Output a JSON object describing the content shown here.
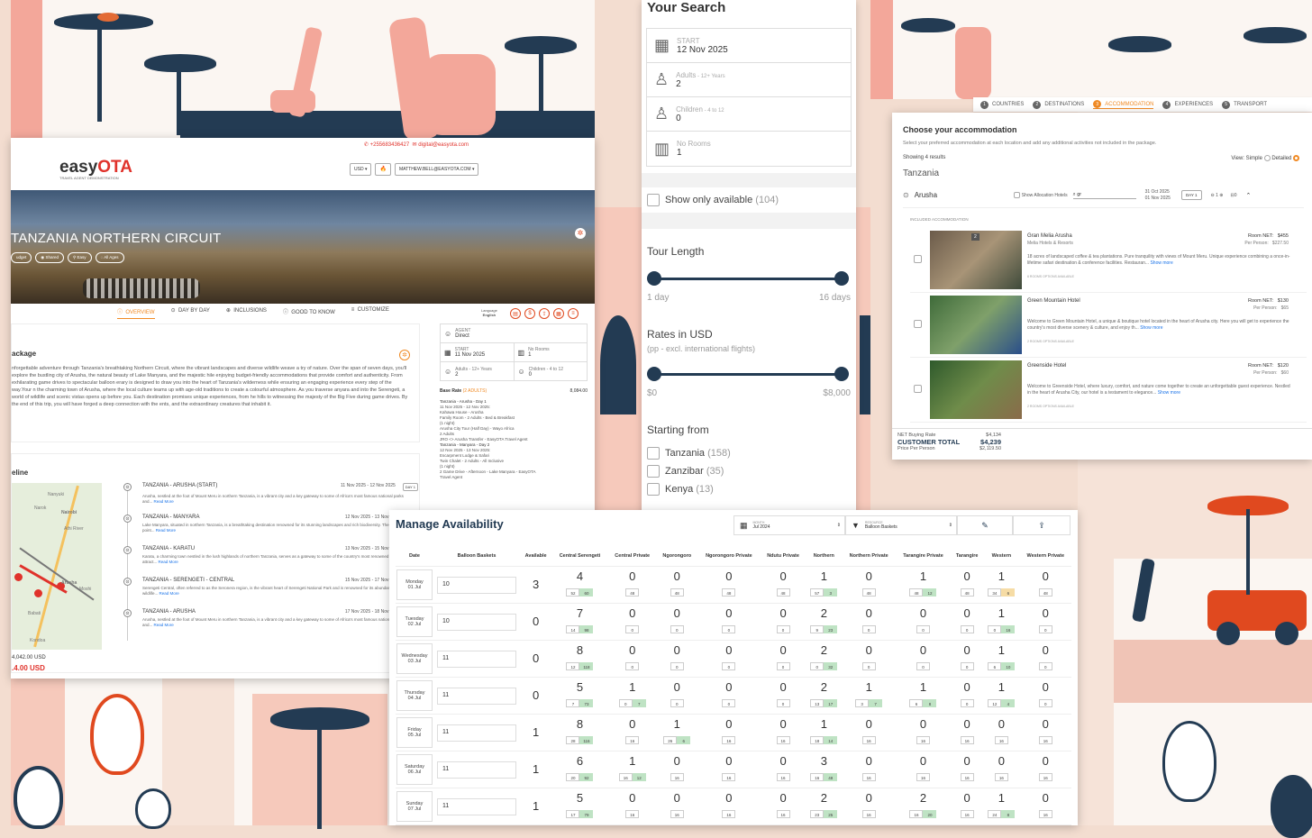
{
  "left_card": {
    "contact_phone": "+255683436427",
    "contact_email": "digital@easyota.com",
    "logo_easy": "easy",
    "logo_ota": "OTA",
    "logo_tagline": "TRAVEL AGENT DEMONSTRATION",
    "currency": "USD ▾",
    "user": "MATTHEW.BELL@EASYOTA.COM ▾",
    "hero_title": "TANZANIA NORTHERN CIRCUIT",
    "hero_tags": [
      "udget",
      "Shared",
      "Easy",
      "All Ages"
    ],
    "tabs": [
      "OVERVIEW",
      "DAY BY DAY",
      "INCLUSIONS",
      "GOOD TO KNOW",
      "CUSTOMIZE"
    ],
    "language_label": "Language",
    "language_value": "English",
    "package_title": "ackage",
    "package_text": "nforgettable adventure through Tanzania's breathtaking Northern Circuit, where the vibrant landscapes and diverse wildlife weave a try of nature. Over the span of seven days, you'll explore the bustling city of Arusha, the natural beauty of Lake Manyara, and the majestic hile enjoying budget-friendly accommodations that provide comfort and authenticity. From exhilarating game drives to spectacular balloon erary is designed to draw you into the heart of Tanzania's wilderness while ensuring an engaging experience every step of the way.Your n the charming town of Arusha, where the local culture teams up with age-old traditions to create a colourful atmosphere. As you traverse anyara and into the Serengeti, a world of wildlife and scenic vistas opens up before you. Each destination promises unique experiences, from he hills to witnessing the majesty of the Big Five during game drives. By the end of this trip, you will have forged a deep connection with the ents, and the extraordinary creatures that inhabit it.",
    "agent_label": "AGENT",
    "agent_value": "Direct",
    "start_label": "START",
    "start_value": "11 Nov 2025",
    "rooms_label": "No Rooms",
    "rooms_value": "1",
    "adults_label": "Adults - 12+ Years",
    "adults_value": "2",
    "children_label": "Children - 4 to 12",
    "children_value": "0",
    "base_rate_label": "Base Rate",
    "base_rate_sub": "(2 ADULTS)",
    "base_rate_value": "8,084.00",
    "itinerary_lines": [
      "Tanzania - Arusha - Day 1",
      "11 Nov 2025 - 12 Nov 2025:",
      "Kahawa House - Arusha",
      "Family Room - 2 Adults - Bed & Breakfast",
      "(1 night)",
      "Arusha City Tour (Half Day) - Wayo Africa",
      "2 Adults",
      "JRO <> Arusha Transfer - EasyOTA Travel Agent",
      "Tanzania - Manyara - Day 2",
      "12 Nov 2025 - 13 Nov 2025:",
      "Escarpment Lodge & Safari",
      "Twin Chalet - 2 Adults - All Inclusive",
      "(1 night)",
      "2 Game Drive - Afternoon - Lake Manyara - EasyOTA",
      "Travel Agent"
    ],
    "timeline_title": "eline",
    "map_labels": [
      "Nanyuki",
      "Narok",
      "Nairobi",
      "Athi River",
      "Arusha",
      "Moshi",
      "Babati",
      "Kondoa"
    ],
    "timeline": [
      {
        "title": "TANZANIA - ARUSHA (START)",
        "dates": "11 Nov 2025 - 12 Nov 2025",
        "badge": "DAY 1",
        "desc": "Arusha, nestled at the foot of Mount Meru in northern Tanzania, is a vibrant city and a key gateway to some of Africa's most famous national parks and...",
        "more": "Read More"
      },
      {
        "title": "TANZANIA - MANYARA",
        "dates": "12 Nov 2025 - 13 Nov 2025",
        "badge": "",
        "desc": "Lake Manyara, situated in northern Tanzania, is a breathtaking destination renowned for its stunning landscapes and rich biodiversity. The focal point...",
        "more": "Read More"
      },
      {
        "title": "TANZANIA - KARATU",
        "dates": "13 Nov 2025 - 15 Nov 2025",
        "badge": "",
        "desc": "Karatu, a charming town nestled in the lush highlands of northern Tanzania, serves as a gateway to some of the country's most renowned natural attract...",
        "more": "Read More"
      },
      {
        "title": "TANZANIA - SERENGETI - CENTRAL",
        "dates": "15 Nov 2025 - 17 Nov 2025",
        "badge": "",
        "desc": "Serengeti Central, often referred to as the Seronera region, is the vibrant heart of Serengeti National Park and is renowned for its abundant wildlife...",
        "more": "Read More"
      },
      {
        "title": "TANZANIA - ARUSHA",
        "dates": "17 Nov 2025 - 18 Nov 2025",
        "badge": "",
        "desc": "Arusha, nestled at the foot of Mount Meru in northern Tanzania, is a vibrant city and a key gateway to some of Africa's most famous national parks and...",
        "more": "Read More"
      }
    ],
    "price_total": "4,042.00 USD",
    "price_pp": ".4.00 USD"
  },
  "search": {
    "title": "Your Search",
    "start_label": "START",
    "start_value": "12 Nov 2025",
    "adults_label": "Adults",
    "adults_sub": " - 12+ Years",
    "adults_value": "2",
    "children_label": "Children",
    "children_sub": " - 4 to 12",
    "children_value": "0",
    "rooms_label": "No Rooms",
    "rooms_value": "1",
    "show_available": "Show only available",
    "show_available_count": "(104)",
    "tour_length_title": "Tour Length",
    "tour_min": "1 day",
    "tour_max": "16 days",
    "rates_title": "Rates in USD",
    "rates_sub": "(pp - excl. international flights)",
    "rates_min": "$0",
    "rates_max": "$8,000",
    "starting_title": "Starting from",
    "starting_options": [
      {
        "name": "Tanzania",
        "count": "(158)"
      },
      {
        "name": "Zanzibar",
        "count": "(35)"
      },
      {
        "name": "Kenya",
        "count": "(13)"
      }
    ]
  },
  "accommodation": {
    "steps": [
      {
        "num": "1",
        "label": "COUNTRIES"
      },
      {
        "num": "2",
        "label": "DESTINATIONS"
      },
      {
        "num": "3",
        "label": "ACCOMMODATION"
      },
      {
        "num": "4",
        "label": "EXPERIENCES"
      },
      {
        "num": "5",
        "label": "TRANSPORT"
      }
    ],
    "title": "Choose your accommodation",
    "subtitle": "Select your preferred accommodation at each location and add any additional activities not included in the package.",
    "showing": "Showing 4 results",
    "view_label": "View:",
    "view_simple": "Simple",
    "view_detailed": "Detailed",
    "country": "Tanzania",
    "location": "Arusha",
    "show_alloc": "Show Allocation Hotels",
    "search_value": "gr",
    "date_from": "31 Oct 2025",
    "date_to": "01 Nov 2025",
    "day_badge": "DAY 1",
    "stepper": "1",
    "rooms_badge": "0",
    "included": "INCLUDED ACCOMMODATION",
    "hotels": [
      {
        "name": "Gran Melia Arusha",
        "sub": "Melia Hotels & Resorts",
        "room_net": "Room NET:",
        "room_net_val": "$455",
        "pp": "Per Person:",
        "pp_val": "$227.50",
        "desc": "18 acres of landscaped coffee & tea plantations. Pure tranquility with views of Mount Meru. Unique experience combining a once-in-lifetime safari destination & conference facilities. Restauran...",
        "more": "Show more",
        "options": "6 ROOMS OPTIONS AVAILABLE",
        "photo_badge": "2"
      },
      {
        "name": "Green Mountain Hotel",
        "sub": "",
        "room_net": "Room NET:",
        "room_net_val": "$130",
        "pp": "Per Person:",
        "pp_val": "$65",
        "desc": "Welcome to Green Mountain Hotel, a unique & boutique hotel located in the heart of Arusha city. Here you will get to experience the country's most diverse scenery & culture, and enjoy th...",
        "more": "Show more",
        "options": "2 ROOMS OPTIONS AVAILABLE",
        "photo_badge": ""
      },
      {
        "name": "Greenside Hotel",
        "sub": "",
        "room_net": "Room NET:",
        "room_net_val": "$120",
        "pp": "Per Person:",
        "pp_val": "$60",
        "desc": "Welcome to Greenside Hotel, where luxury, comfort, and nature come together to create an unforgettable guest experience. Nestled in the heart of Arusha City, our hotel is a testament to elegance...",
        "more": "Show more",
        "options": "2 ROOMS OPTIONS AVAILABLE",
        "photo_badge": ""
      }
    ],
    "net_label": "NET Buying Rate",
    "net_val": "$4,134",
    "cust_label": "CUSTOMER TOTAL",
    "cust_val": "$4,239",
    "ppp_label": "Price Per Person",
    "ppp_val": "$2,119.50"
  },
  "availability": {
    "title": "Manage Availability",
    "month_label": "MONTH",
    "month_value": "Jul 2024",
    "resource_label": "RESOURCE",
    "resource_value": "Balloon Baskets",
    "headers": [
      "Date",
      "Balloon Baskets",
      "Available",
      "Central Serengeti",
      "Central Private",
      "Ngorongoro",
      "Ngorongoro Private",
      "Ndutu Private",
      "Northern",
      "Northern Private",
      "Tarangire Private",
      "Tarangire",
      "Western",
      "Western Private"
    ],
    "rows": [
      {
        "day": "Monday",
        "date": "01 Jul",
        "baskets": "10",
        "available": "3",
        "cells": [
          [
            "4",
            "52",
            "60"
          ],
          [
            "0",
            "48"
          ],
          [
            "0",
            "48"
          ],
          [
            "0",
            "48"
          ],
          [
            "0",
            "48"
          ],
          [
            "1",
            "57",
            "3"
          ],
          [
            "0",
            "48"
          ],
          [
            "1",
            "48",
            "12"
          ],
          [
            "0",
            "48"
          ],
          [
            "1",
            "34",
            "6"
          ],
          [
            "0",
            "48"
          ]
        ]
      },
      {
        "day": "Tuesday",
        "date": "02 Jul",
        "baskets": "10",
        "available": "0",
        "cells": [
          [
            "7",
            "14",
            "98"
          ],
          [
            "0",
            "0"
          ],
          [
            "0",
            "0"
          ],
          [
            "0",
            "0"
          ],
          [
            "0",
            "0"
          ],
          [
            "2",
            "9",
            "23"
          ],
          [
            "0",
            "0"
          ],
          [
            "0",
            "0"
          ],
          [
            "0",
            "0"
          ],
          [
            "1",
            "0",
            "16"
          ],
          [
            "0",
            "0"
          ]
        ]
      },
      {
        "day": "Wednesday",
        "date": "03 Jul",
        "baskets": "11",
        "available": "0",
        "cells": [
          [
            "8",
            "12",
            "118"
          ],
          [
            "0",
            "0"
          ],
          [
            "0",
            "0"
          ],
          [
            "0",
            "0"
          ],
          [
            "0",
            "0"
          ],
          [
            "2",
            "0",
            "32"
          ],
          [
            "0",
            "0"
          ],
          [
            "0",
            "0"
          ],
          [
            "0",
            "0"
          ],
          [
            "1",
            "6",
            "10"
          ],
          [
            "0",
            "0"
          ]
        ]
      },
      {
        "day": "Thursday",
        "date": "04 Jul",
        "baskets": "11",
        "available": "0",
        "cells": [
          [
            "5",
            "7",
            "73"
          ],
          [
            "1",
            "0",
            "7"
          ],
          [
            "0",
            "0"
          ],
          [
            "0",
            "0"
          ],
          [
            "0",
            "0"
          ],
          [
            "2",
            "13",
            "17"
          ],
          [
            "1",
            "3",
            "7"
          ],
          [
            "1",
            "6",
            "8"
          ],
          [
            "0",
            "0"
          ],
          [
            "1",
            "12",
            "4"
          ],
          [
            "0",
            "0"
          ]
        ]
      },
      {
        "day": "Friday",
        "date": "05 Jul",
        "baskets": "11",
        "available": "1",
        "cells": [
          [
            "8",
            "28",
            "116"
          ],
          [
            "0",
            "16"
          ],
          [
            "1",
            "26",
            "6"
          ],
          [
            "0",
            "16"
          ],
          [
            "0",
            "16"
          ],
          [
            "1",
            "18",
            "14"
          ],
          [
            "0",
            "16"
          ],
          [
            "0",
            "16"
          ],
          [
            "0",
            "16"
          ],
          [
            "0",
            "16"
          ],
          [
            "0",
            "16"
          ]
        ]
      },
      {
        "day": "Saturday",
        "date": "06 Jul",
        "baskets": "11",
        "available": "1",
        "cells": [
          [
            "6",
            "20",
            "92"
          ],
          [
            "1",
            "16",
            "12"
          ],
          [
            "0",
            "16"
          ],
          [
            "0",
            "16"
          ],
          [
            "0",
            "16"
          ],
          [
            "3",
            "16",
            "48"
          ],
          [
            "0",
            "16"
          ],
          [
            "0",
            "16"
          ],
          [
            "0",
            "16"
          ],
          [
            "0",
            "16"
          ],
          [
            "0",
            "16"
          ]
        ]
      },
      {
        "day": "Sunday",
        "date": "07 Jul",
        "baskets": "11",
        "available": "1",
        "cells": [
          [
            "5",
            "17",
            "79"
          ],
          [
            "0",
            "16"
          ],
          [
            "0",
            "16"
          ],
          [
            "0",
            "16"
          ],
          [
            "0",
            "16"
          ],
          [
            "2",
            "23",
            "25"
          ],
          [
            "0",
            "16"
          ],
          [
            "2",
            "16",
            "20"
          ],
          [
            "0",
            "16"
          ],
          [
            "1",
            "24",
            "8"
          ],
          [
            "0",
            "16"
          ]
        ]
      }
    ]
  },
  "colors": {
    "navy": "#233b53",
    "pink": "#f3a79a",
    "orange": "#f08a24",
    "red": "#e0322b",
    "bg": "#f3ddd0"
  }
}
